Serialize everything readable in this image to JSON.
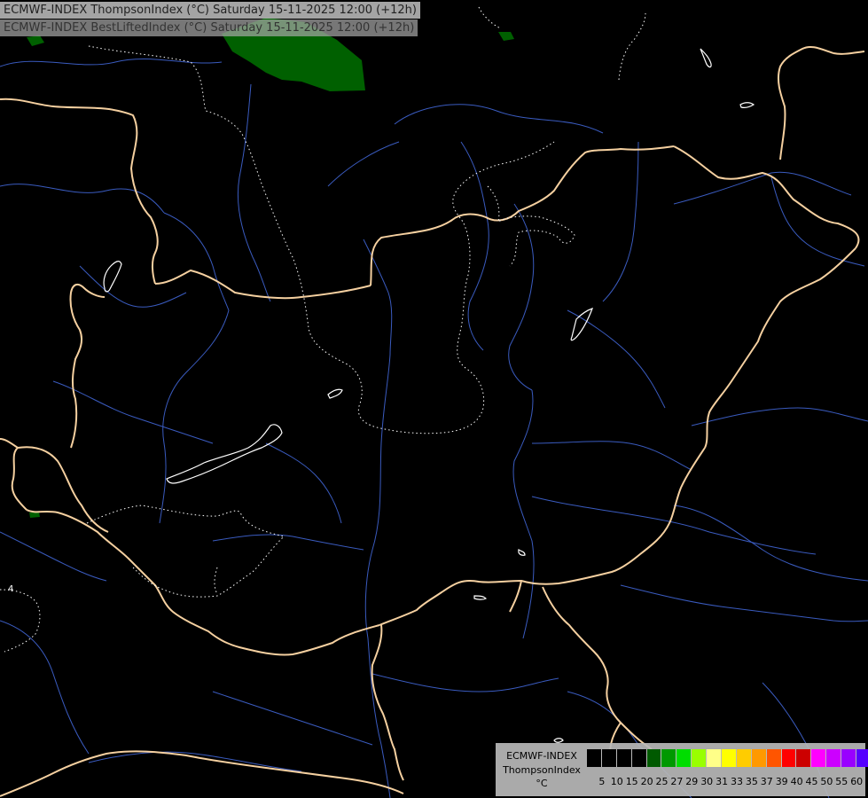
{
  "titles": {
    "line1": "ECMWF-INDEX ThompsonIndex (°C) Saturday 15-11-2025 12:00 (+12h)",
    "line2": "ECMWF-INDEX BestLiftedIndex (°C) Saturday 15-11-2025 12:00 (+12h)"
  },
  "legend": {
    "line1": "ECMWF-INDEX",
    "line2": "ThompsonIndex",
    "line3": "°C",
    "colors": [
      "#000000",
      "#000000",
      "#000000",
      "#000000",
      "#005a00",
      "#009900",
      "#00dd00",
      "#99ff00",
      "#ffff88",
      "#ffff00",
      "#ffcc00",
      "#ff9900",
      "#ff5500",
      "#ff0000",
      "#cc0000",
      "#ff00ff",
      "#cc00ff",
      "#9900ff",
      "#5500ff",
      "#0000ff"
    ],
    "ticks": [
      "5",
      "10",
      "15",
      "20",
      "25",
      "27",
      "29",
      "30",
      "31",
      "33",
      "35",
      "37",
      "39",
      "40",
      "45",
      "50",
      "55",
      "60"
    ]
  },
  "map": {
    "contour_label": "4",
    "colors": {
      "background": "#000000",
      "border": "#f5d0a0",
      "river": "#3a5bbf",
      "lake": "#ffffff",
      "contour": "#ffffff",
      "thompson_fill": "#006000"
    }
  }
}
